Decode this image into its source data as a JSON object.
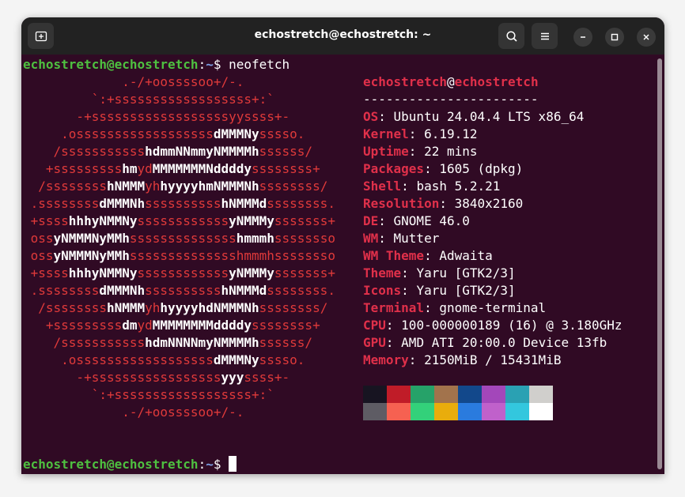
{
  "window": {
    "title": "echostretch@echostretch: ~"
  },
  "prompt": {
    "user_host": "echostretch@echostretch",
    "sep": ":",
    "path": "~",
    "symbol": "$",
    "command": "neofetch"
  },
  "logo_lines": [
    [
      [
        "r",
        "             .-/+oossssoo+/-."
      ]
    ],
    [
      [
        "r",
        "         `:+ssssssssssssssssss+:`"
      ]
    ],
    [
      [
        "r",
        "       -+ssssssssssssssssssyyssss+-"
      ]
    ],
    [
      [
        "r",
        "     .ossssssssssssssssss"
      ],
      [
        "wb",
        "dMMMNy"
      ],
      [
        "r",
        "sssso."
      ]
    ],
    [
      [
        "r",
        "    /sssssssssss"
      ],
      [
        "wb",
        "hdmmNNmmyNMMMMh"
      ],
      [
        "r",
        "ssssss/"
      ]
    ],
    [
      [
        "r",
        "   +sssssssss"
      ],
      [
        "wb",
        "hm"
      ],
      [
        "r",
        "yd"
      ],
      [
        "wb",
        "MMMMMMMNddddy"
      ],
      [
        "r",
        "ssssssss+"
      ]
    ],
    [
      [
        "r",
        "  /ssssssss"
      ],
      [
        "wb",
        "hNMMM"
      ],
      [
        "r",
        "yh"
      ],
      [
        "wb",
        "hyyyyhmNMMMNh"
      ],
      [
        "r",
        "ssssssss/"
      ]
    ],
    [
      [
        "r",
        " .ssssssss"
      ],
      [
        "wb",
        "dMMMNh"
      ],
      [
        "r",
        "ssssssssss"
      ],
      [
        "wb",
        "hNMMMd"
      ],
      [
        "r",
        "ssssssss."
      ]
    ],
    [
      [
        "r",
        " +ssss"
      ],
      [
        "wb",
        "hhhyNMMNy"
      ],
      [
        "r",
        "ssssssssssss"
      ],
      [
        "wb",
        "yNMMMy"
      ],
      [
        "r",
        "sssssss+"
      ]
    ],
    [
      [
        "r",
        " oss"
      ],
      [
        "wb",
        "yNMMMNyMMh"
      ],
      [
        "r",
        "ssssssssssssss"
      ],
      [
        "wb",
        "hmmmh"
      ],
      [
        "r",
        "ssssssso"
      ]
    ],
    [
      [
        "r",
        " oss"
      ],
      [
        "wb",
        "yNMMMNyMMh"
      ],
      [
        "r",
        "sssssssssssssshmmmhssssssso"
      ]
    ],
    [
      [
        "r",
        " +ssss"
      ],
      [
        "wb",
        "hhhyNMMNy"
      ],
      [
        "r",
        "ssssssssssss"
      ],
      [
        "wb",
        "yNMMMy"
      ],
      [
        "r",
        "sssssss+"
      ]
    ],
    [
      [
        "r",
        " .ssssssss"
      ],
      [
        "wb",
        "dMMMNh"
      ],
      [
        "r",
        "ssssssssss"
      ],
      [
        "wb",
        "hNMMMd"
      ],
      [
        "r",
        "ssssssss."
      ]
    ],
    [
      [
        "r",
        "  /ssssssss"
      ],
      [
        "wb",
        "hNMMM"
      ],
      [
        "r",
        "yh"
      ],
      [
        "wb",
        "hyyyyhdNMMMNh"
      ],
      [
        "r",
        "ssssssss/"
      ]
    ],
    [
      [
        "r",
        "   +sssssssss"
      ],
      [
        "wb",
        "dm"
      ],
      [
        "r",
        "yd"
      ],
      [
        "wb",
        "MMMMMMMMddddy"
      ],
      [
        "r",
        "ssssssss+"
      ]
    ],
    [
      [
        "r",
        "    /sssssssssss"
      ],
      [
        "wb",
        "hdmNNNNmyNMMMMh"
      ],
      [
        "r",
        "ssssss/"
      ]
    ],
    [
      [
        "r",
        "     .ossssssssssssssssss"
      ],
      [
        "wb",
        "dMMMNy"
      ],
      [
        "r",
        "sssso."
      ]
    ],
    [
      [
        "r",
        "       -+sssssssssssssssss"
      ],
      [
        "wb",
        "yyy"
      ],
      [
        "r",
        "ssss+-"
      ]
    ],
    [
      [
        "r",
        "         `:+ssssssssssssssssss+:`"
      ]
    ],
    [
      [
        "r",
        "             .-/+oossssoo+/-."
      ]
    ]
  ],
  "info": {
    "user": "echostretch",
    "at": "@",
    "host": "echostretch",
    "underline": "-----------------------",
    "rows": [
      {
        "key": "OS",
        "value": "Ubuntu 24.04.4 LTS x86_64"
      },
      {
        "key": "Kernel",
        "value": "6.19.12"
      },
      {
        "key": "Uptime",
        "value": "22 mins"
      },
      {
        "key": "Packages",
        "value": "1605 (dpkg)"
      },
      {
        "key": "Shell",
        "value": "bash 5.2.21"
      },
      {
        "key": "Resolution",
        "value": "3840x2160"
      },
      {
        "key": "DE",
        "value": "GNOME 46.0"
      },
      {
        "key": "WM",
        "value": "Mutter"
      },
      {
        "key": "WM Theme",
        "value": "Adwaita"
      },
      {
        "key": "Theme",
        "value": "Yaru [GTK2/3]"
      },
      {
        "key": "Icons",
        "value": "Yaru [GTK2/3]"
      },
      {
        "key": "Terminal",
        "value": "gnome-terminal"
      },
      {
        "key": "CPU",
        "value": "100-000000189 (16) @ 3.180GHz"
      },
      {
        "key": "GPU",
        "value": "AMD ATI 20:00.0 Device 13fb"
      },
      {
        "key": "Memory",
        "value": "2150MiB / 15431MiB"
      }
    ]
  },
  "palette": {
    "top": [
      "#171421",
      "#c01c28",
      "#26a269",
      "#a2734c",
      "#12488b",
      "#a347ba",
      "#2aa1b3",
      "#d0cfcc"
    ],
    "bottom": [
      "#5e5c64",
      "#f66151",
      "#33d17a",
      "#e9ad0c",
      "#2a7bde",
      "#c061cb",
      "#33c7de",
      "#ffffff"
    ]
  },
  "colors": {
    "terminal_bg": "#300a24",
    "prompt_green": "#4ec040",
    "path_blue": "#7ca0e5",
    "ascii_red": "#e03a3a",
    "key_red": "#e0304a"
  }
}
